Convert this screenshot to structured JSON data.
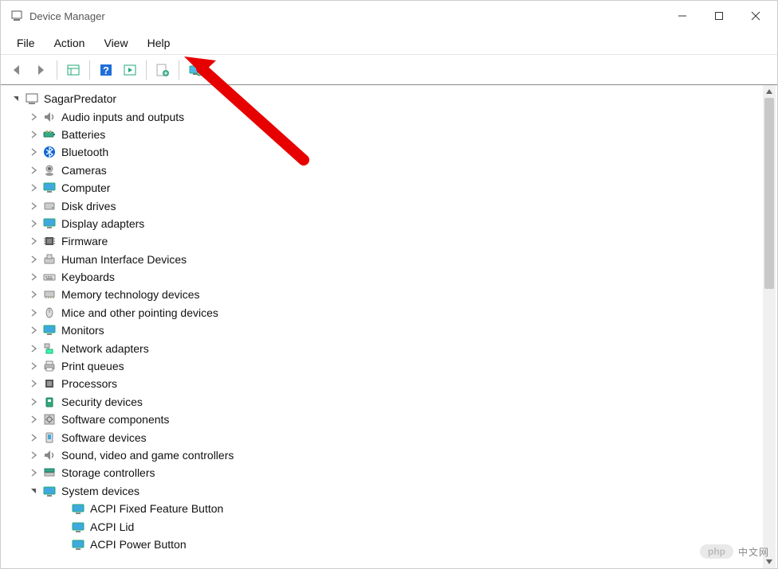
{
  "window": {
    "title": "Device Manager"
  },
  "menubar": {
    "items": [
      "File",
      "Action",
      "View",
      "Help"
    ]
  },
  "toolbar": {
    "buttons": [
      {
        "name": "back-button"
      },
      {
        "name": "forward-button"
      },
      {
        "sep": true
      },
      {
        "name": "show-hide-tree-button"
      },
      {
        "sep": true
      },
      {
        "name": "help-button"
      },
      {
        "name": "action-button"
      },
      {
        "sep": true
      },
      {
        "name": "update-driver-button"
      },
      {
        "sep": true
      },
      {
        "name": "add-hardware-button"
      }
    ]
  },
  "tree": {
    "root": {
      "label": "SagarPredator",
      "expanded": true,
      "icon": "computer-icon"
    },
    "children": [
      {
        "label": "Audio inputs and outputs",
        "icon": "speaker-icon",
        "expander": true
      },
      {
        "label": "Batteries",
        "icon": "battery-icon",
        "expander": true
      },
      {
        "label": "Bluetooth",
        "icon": "bluetooth-icon",
        "expander": true
      },
      {
        "label": "Cameras",
        "icon": "camera-icon",
        "expander": true
      },
      {
        "label": "Computer",
        "icon": "monitor-icon",
        "expander": true
      },
      {
        "label": "Disk drives",
        "icon": "disk-icon",
        "expander": true
      },
      {
        "label": "Display adapters",
        "icon": "display-icon",
        "expander": true
      },
      {
        "label": "Firmware",
        "icon": "chip-icon",
        "expander": true
      },
      {
        "label": "Human Interface Devices",
        "icon": "hid-icon",
        "expander": true
      },
      {
        "label": "Keyboards",
        "icon": "keyboard-icon",
        "expander": true
      },
      {
        "label": "Memory technology devices",
        "icon": "memory-icon",
        "expander": true
      },
      {
        "label": "Mice and other pointing devices",
        "icon": "mouse-icon",
        "expander": true
      },
      {
        "label": "Monitors",
        "icon": "monitor-icon",
        "expander": true
      },
      {
        "label": "Network adapters",
        "icon": "network-icon",
        "expander": true
      },
      {
        "label": "Print queues",
        "icon": "printer-icon",
        "expander": true
      },
      {
        "label": "Processors",
        "icon": "cpu-icon",
        "expander": true
      },
      {
        "label": "Security devices",
        "icon": "security-icon",
        "expander": true
      },
      {
        "label": "Software components",
        "icon": "software-icon",
        "expander": true
      },
      {
        "label": "Software devices",
        "icon": "software-device-icon",
        "expander": true
      },
      {
        "label": "Sound, video and game controllers",
        "icon": "speaker-icon",
        "expander": true
      },
      {
        "label": "Storage controllers",
        "icon": "storage-icon",
        "expander": true
      },
      {
        "label": "System devices",
        "icon": "system-icon",
        "expander": true,
        "expanded": true,
        "children": [
          {
            "label": "ACPI Fixed Feature Button",
            "icon": "system-icon"
          },
          {
            "label": "ACPI Lid",
            "icon": "system-icon"
          },
          {
            "label": "ACPI Power Button",
            "icon": "system-icon"
          }
        ]
      }
    ]
  },
  "watermark": {
    "brand": "php",
    "text": "中文网"
  }
}
